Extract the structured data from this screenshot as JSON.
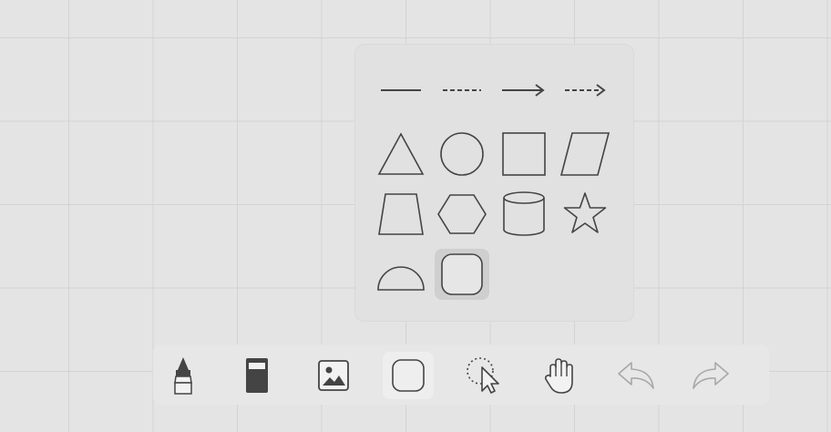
{
  "app": {
    "canvas_name": "whiteboard-canvas",
    "colors": {
      "background": "#e4e4e4",
      "grid_line": "#d3d3d3",
      "panel": "#e1e1e1",
      "selected_cell": "#cfcfcf",
      "icon_stroke": "#444444",
      "icon_disabled": "#a8a8a8"
    }
  },
  "shape_panel": {
    "lines": [
      {
        "name": "line-solid",
        "icon": "solid-line-icon"
      },
      {
        "name": "line-dashed",
        "icon": "dashed-line-icon"
      },
      {
        "name": "arrow-solid",
        "icon": "solid-arrow-icon"
      },
      {
        "name": "arrow-dashed",
        "icon": "dashed-arrow-icon"
      }
    ],
    "shapes": [
      {
        "name": "triangle",
        "icon": "triangle-icon"
      },
      {
        "name": "circle",
        "icon": "circle-icon"
      },
      {
        "name": "square",
        "icon": "square-icon"
      },
      {
        "name": "parallelogram",
        "icon": "parallelogram-icon"
      },
      {
        "name": "trapezoid",
        "icon": "trapezoid-icon"
      },
      {
        "name": "hexagon",
        "icon": "hexagon-icon"
      },
      {
        "name": "cylinder",
        "icon": "cylinder-icon"
      },
      {
        "name": "star",
        "icon": "star-icon"
      },
      {
        "name": "semicircle",
        "icon": "semicircle-icon"
      },
      {
        "name": "rounded-square",
        "icon": "rounded-square-icon",
        "selected": true
      }
    ]
  },
  "toolbar": {
    "tools": [
      {
        "name": "marker",
        "icon": "marker-icon"
      },
      {
        "name": "eraser",
        "icon": "eraser-icon"
      },
      {
        "name": "image",
        "icon": "image-icon"
      },
      {
        "name": "shape",
        "icon": "rounded-square-icon",
        "active": true
      },
      {
        "name": "lasso-select",
        "icon": "lasso-select-icon"
      },
      {
        "name": "hand-pan",
        "icon": "hand-icon"
      },
      {
        "name": "undo",
        "icon": "undo-icon",
        "disabled": true
      },
      {
        "name": "redo",
        "icon": "redo-icon",
        "disabled": true
      }
    ]
  }
}
